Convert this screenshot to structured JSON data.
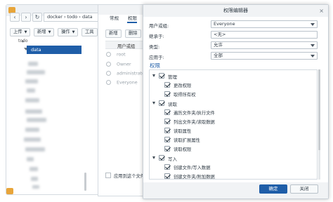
{
  "file_station": {
    "nav": {
      "back": "‹",
      "forward": "›",
      "refresh": "↻"
    },
    "path": "docker › todo › data",
    "toolbar": {
      "upload": "上传",
      "create": "新增",
      "action": "操作",
      "tools": "工具"
    },
    "tree": {
      "parent": "todo",
      "selected": "data"
    }
  },
  "properties": {
    "tabs": {
      "general": "常规",
      "permission": "权限"
    },
    "buttons": {
      "add": "新增",
      "delete": "删除"
    },
    "grid_header": "用户或组",
    "users": [
      "root",
      "Owner",
      "administrators",
      "Everyone"
    ],
    "apply_label": "应用到这个文件夹"
  },
  "editor": {
    "title": "权限编辑器",
    "close_glyph": "×",
    "fields": {
      "user_label": "用户或组:",
      "user_value": "Everyone",
      "inherit_label": "继承于:",
      "inherit_value": "<无>",
      "type_label": "类型:",
      "type_value": "允许",
      "apply_label": "应用于:",
      "apply_value": "全部"
    },
    "permissions_heading": "权限",
    "groups": [
      {
        "label": "管理",
        "items": [
          "更改权限",
          "取得所有权"
        ]
      },
      {
        "label": "读取",
        "items": [
          "遍历文件夹/执行文件",
          "列出文件夹/读取数据",
          "读取属性",
          "读取扩展属性",
          "读取权限"
        ]
      },
      {
        "label": "写入",
        "items": [
          "创建文件/写入数据",
          "创建文件夹/附加数据"
        ]
      }
    ],
    "ok_label": "确定",
    "close_label": "关闭"
  },
  "colors": {
    "accent": "#1f5ea8",
    "folder": "#e8a53a"
  }
}
